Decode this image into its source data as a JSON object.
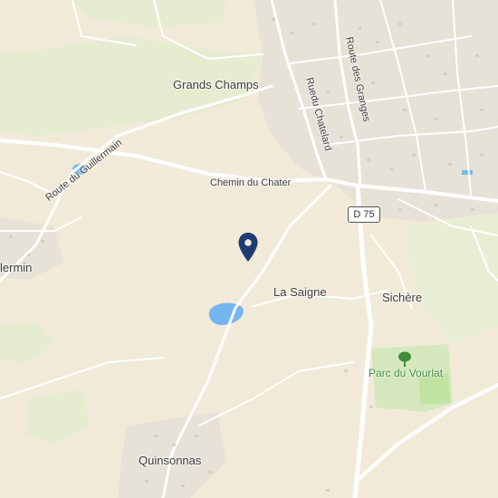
{
  "map": {
    "places": {
      "grands_champs": "Grands Champs",
      "la_saigne": "La Saigne",
      "sichere": "Sichère",
      "quinsonnas": "Quinsonnas",
      "edge_partial": "lermin"
    },
    "roads": {
      "route_du_guillermain": "Route du Guillermain",
      "chemin_du_chater": "Chemin du Chater",
      "rue_du_chatelard": "Ruedu Chatelard",
      "route_des_granges": "Route des Granges"
    },
    "road_shield": "D 75",
    "park": "Parc du Vourlat"
  },
  "colors": {
    "land": "#f2ead8",
    "forest": "#e3ebcc",
    "urban": "#e6e1d6",
    "water": "#74b5f2",
    "road": "#ffffff",
    "park": "#cfe8b4",
    "marker": "#1f3b73"
  },
  "icons": {
    "marker": "location-pin-icon",
    "park": "tree-icon"
  }
}
